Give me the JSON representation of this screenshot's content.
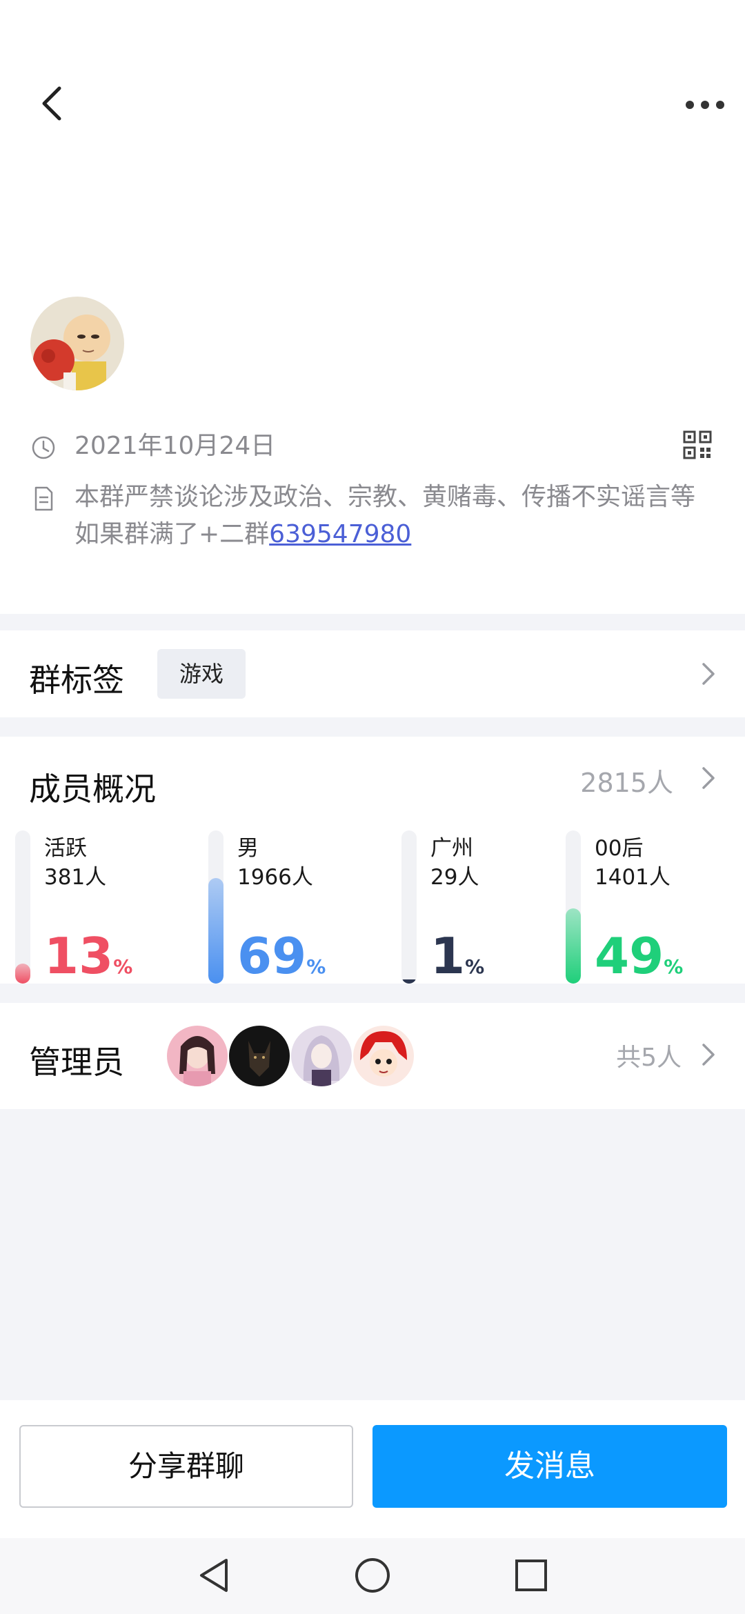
{
  "header": {
    "group_date": "2021年10月24日",
    "description_line1": "本群严禁谈论涉及政治、宗教、黄赌毒、传播不实谣言等",
    "description_prefix": "如果群满了+二群",
    "description_link": "639547980"
  },
  "tags": {
    "title": "群标签",
    "chip": "游戏"
  },
  "members": {
    "title": "成员概况",
    "total": "2815人",
    "stats": [
      {
        "label": "活跃",
        "count": "381人",
        "pct": "13",
        "sign": "%",
        "fraction": 0.13,
        "color": "#ef4f63"
      },
      {
        "label": "男",
        "count": "1966人",
        "pct": "69",
        "sign": "%",
        "fraction": 0.69,
        "color": "#4a90f0"
      },
      {
        "label": "广州",
        "count": "29人",
        "pct": "1",
        "sign": "%",
        "fraction": 0.01,
        "color": "#2c3650"
      },
      {
        "label": "00后",
        "count": "1401人",
        "pct": "49",
        "sign": "%",
        "fraction": 0.49,
        "color": "#1fcf7a"
      }
    ]
  },
  "admins": {
    "title": "管理员",
    "total": "共5人"
  },
  "actions": {
    "share_label": "分享群聊",
    "send_label": "发消息"
  },
  "icons": {
    "back": "back-arrow-icon",
    "more": "more-dots-icon",
    "clock": "clock-icon",
    "document": "document-icon",
    "qr": "qr-code-icon",
    "chevron": "chevron-right-icon",
    "nav_back": "nav-back-icon",
    "nav_home": "nav-home-icon",
    "nav_recent": "nav-recent-icon"
  },
  "colors": {
    "accent": "#0b99ff",
    "link": "#4b5fd6"
  }
}
